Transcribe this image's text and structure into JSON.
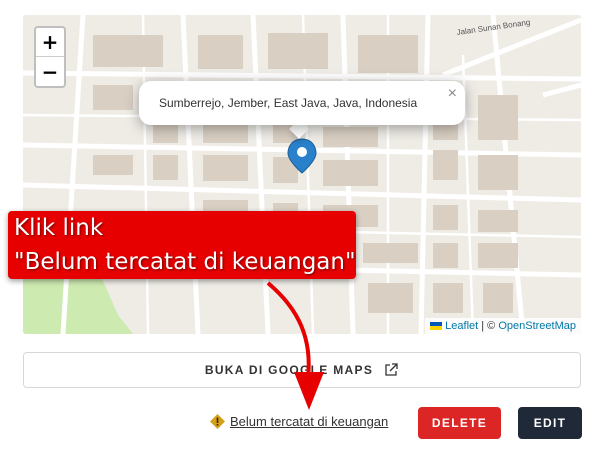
{
  "map": {
    "zoom_in": "+",
    "zoom_out": "−",
    "street_label": "Jalan Sunan Bonang",
    "popup_text": "Sumberrejo, Jember, East Java, Java, Indonesia",
    "popup_close": "×",
    "attribution": {
      "leaflet": "Leaflet",
      "separator": " | © ",
      "osm": "OpenStreetMap"
    }
  },
  "callout": {
    "line1": "Klik link",
    "line2": "\"Belum tercatat di keuangan\""
  },
  "gmaps_button": {
    "label": "BUKA DI GOOGLE MAPS",
    "icon": "external-link-icon"
  },
  "status": {
    "icon": "warning-icon",
    "link_text": "Belum tercatat di keuangan"
  },
  "actions": {
    "delete_label": "DELETE",
    "edit_label": "EDIT"
  },
  "colors": {
    "delete": "#dc2626",
    "edit": "#1f2937",
    "callout": "#e60000",
    "marker": "#2a81cb",
    "warning": "#d4a017"
  }
}
